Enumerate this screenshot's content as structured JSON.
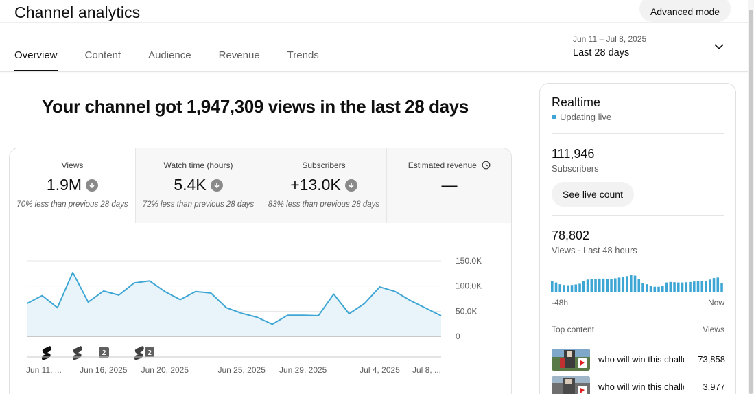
{
  "header": {
    "title": "Channel analytics",
    "advanced_mode_label": "Advanced mode"
  },
  "tabs": [
    {
      "label": "Overview",
      "active": true
    },
    {
      "label": "Content",
      "active": false
    },
    {
      "label": "Audience",
      "active": false
    },
    {
      "label": "Revenue",
      "active": false
    },
    {
      "label": "Trends",
      "active": false
    }
  ],
  "date_picker": {
    "range": "Jun 11 – Jul 8, 2025",
    "label": "Last 28 days",
    "icon": "chevron-down-icon"
  },
  "headline": "Your channel got 1,947,309 views in the last 28 days",
  "metrics": [
    {
      "label": "Views",
      "value": "1.9M",
      "trend": "down",
      "sub": "70% less than previous 28 days"
    },
    {
      "label": "Watch time (hours)",
      "value": "5.4K",
      "trend": "down",
      "sub": "72% less than previous 28 days"
    },
    {
      "label": "Subscribers",
      "value": "+13.0K",
      "trend": "down",
      "sub": "83% less than previous 28 days"
    },
    {
      "label": "Estimated revenue",
      "value": "—",
      "icon": "clock-icon"
    }
  ],
  "chart_data": {
    "type": "area",
    "series": [
      {
        "values": [
          65000,
          81000,
          57000,
          127000,
          68000,
          90000,
          82000,
          106000,
          110000,
          89000,
          73000,
          89000,
          86000,
          57000,
          46000,
          38000,
          24000,
          42000,
          42000,
          41000,
          84000,
          45000,
          65000,
          98000,
          89000,
          71000,
          56000,
          41000
        ]
      }
    ],
    "x_start": "Jun 11, 2025",
    "x_end": "Jul 8, 2025",
    "x_tick_labels": [
      "Jun 11, ...",
      "Jun 16, 2025",
      "Jun 20, 2025",
      "Jun 25, 2025",
      "Jun 29, 2025",
      "Jul 4, 2025",
      "Jul 8, ..."
    ],
    "y_tick_labels": [
      "0",
      "50.0K",
      "100.0K",
      "150.0K"
    ],
    "ylim": [
      0,
      150000
    ],
    "grid": true,
    "color": "#3ea6d4",
    "fill_color": "#e8f4fa",
    "markers": [
      {
        "type": "shorts-icon",
        "count": ""
      },
      {
        "type": "shorts-icon",
        "count": ""
      },
      {
        "type": "badge",
        "count": "2"
      },
      {
        "type": "shorts-icon",
        "count": "2"
      }
    ]
  },
  "realtime": {
    "title": "Realtime",
    "status": "Updating live",
    "subscribers_value": "111,946",
    "subscribers_label": "Subscribers",
    "live_count_label": "See live count",
    "views_value": "78,802",
    "views_label": "Views · Last 48 hours",
    "bars": [
      45,
      40,
      33,
      30,
      29,
      30,
      32,
      35,
      46,
      52,
      53,
      55,
      56,
      56,
      55,
      55,
      57,
      60,
      63,
      66,
      70,
      68,
      55,
      38,
      33,
      27,
      23,
      23,
      25,
      40,
      42,
      41,
      40,
      40,
      41,
      42,
      44,
      45,
      46,
      47,
      52,
      58,
      60,
      38
    ],
    "axis_left": "-48h",
    "axis_right": "Now",
    "top_content_label": "Top content",
    "views_col_label": "Views",
    "top_content": [
      {
        "title": "who will win this challenge",
        "views": "73,858"
      },
      {
        "title": "who will win this challenge",
        "views": "3,977"
      }
    ]
  }
}
